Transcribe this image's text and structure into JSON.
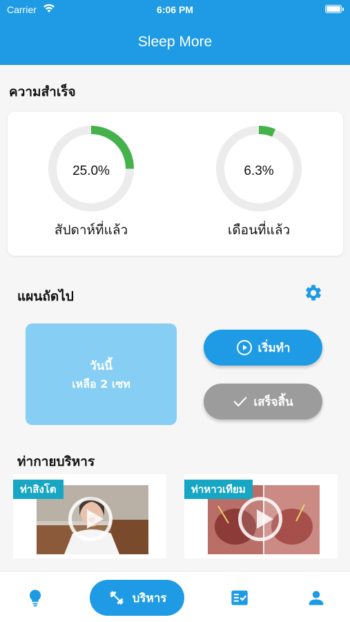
{
  "status_bar": {
    "carrier": "Carrier",
    "time": "6:06 PM"
  },
  "nav": {
    "title": "Sleep More"
  },
  "achievements": {
    "title": "ความสำเร็จ",
    "week": {
      "value_text": "25.0%",
      "fraction": 0.25,
      "label": "สัปดาห์ที่แล้ว"
    },
    "month": {
      "value_text": "6.3%",
      "fraction": 0.063,
      "label": "เดือนที่แล้ว"
    }
  },
  "plan": {
    "title": "แผนถัดไป",
    "day": "วันนี้",
    "sets": "เหลือ 2 เซท",
    "start_label": "เริ่มทำ",
    "done_label": "เสร็จสิ้น"
  },
  "exercises": {
    "title": "ท่ากายบริหาร",
    "items": [
      {
        "tag": "ท่าสิงโต"
      },
      {
        "tag": "ท่าหาวเทียม"
      }
    ]
  },
  "tab_bar": {
    "center_label": "บริหาร"
  },
  "colors": {
    "brand": "#1e9be4",
    "progress": "#44b14a",
    "track": "#ececec",
    "plan_box": "#87cef4",
    "done_button": "#9c9c9c",
    "tag": "#17a6c3"
  }
}
